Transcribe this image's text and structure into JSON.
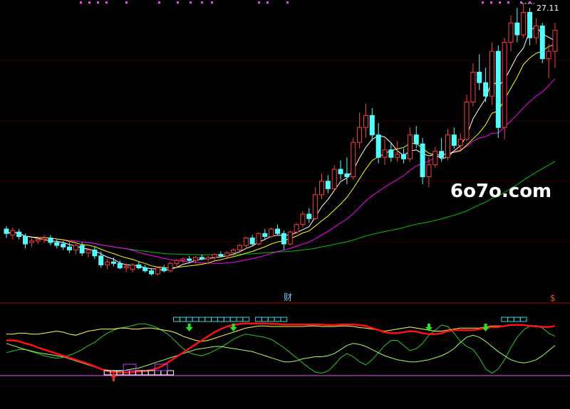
{
  "chart_data": {
    "type": "candlestick",
    "panels": [
      "price",
      "indicator"
    ],
    "price": {
      "last_price_label": "27.11",
      "ohlc": [
        [
          12.8,
          13.0,
          12.2,
          12.5
        ],
        [
          12.4,
          12.9,
          12.1,
          12.7
        ],
        [
          12.6,
          12.8,
          12.1,
          12.3
        ],
        [
          12.3,
          12.5,
          11.5,
          11.8
        ],
        [
          11.9,
          12.2,
          11.6,
          12.0
        ],
        [
          12.0,
          12.3,
          11.8,
          12.1
        ],
        [
          12.1,
          12.4,
          11.9,
          12.2
        ],
        [
          12.2,
          12.4,
          11.7,
          11.9
        ],
        [
          11.9,
          12.1,
          11.5,
          11.7
        ],
        [
          11.8,
          12.0,
          11.4,
          11.6
        ],
        [
          11.6,
          11.9,
          11.2,
          11.4
        ],
        [
          11.4,
          11.8,
          11.1,
          11.7
        ],
        [
          11.7,
          11.9,
          11.0,
          11.2
        ],
        [
          11.2,
          11.5,
          10.9,
          11.4
        ],
        [
          11.4,
          11.6,
          10.8,
          11.0
        ],
        [
          11.0,
          11.3,
          10.2,
          10.4
        ],
        [
          10.4,
          10.8,
          10.1,
          10.6
        ],
        [
          10.6,
          10.9,
          10.3,
          10.5
        ],
        [
          10.5,
          10.7,
          10.1,
          10.2
        ],
        [
          10.2,
          10.5,
          9.9,
          10.3
        ],
        [
          10.1,
          10.5,
          9.9,
          10.4
        ],
        [
          10.4,
          10.6,
          10.1,
          10.2
        ],
        [
          10.2,
          10.4,
          9.9,
          10.0
        ],
        [
          10.0,
          10.2,
          9.7,
          9.8
        ],
        [
          9.8,
          10.3,
          9.7,
          10.2
        ],
        [
          10.2,
          10.4,
          9.9,
          10.0
        ],
        [
          10.0,
          10.6,
          9.9,
          10.5
        ],
        [
          10.5,
          10.8,
          10.3,
          10.7
        ],
        [
          10.7,
          10.9,
          10.5,
          10.8
        ],
        [
          10.8,
          11.0,
          10.6,
          10.7
        ],
        [
          10.7,
          11.0,
          10.5,
          10.9
        ],
        [
          10.9,
          11.1,
          10.7,
          10.8
        ],
        [
          10.8,
          11.0,
          10.6,
          10.9
        ],
        [
          10.9,
          11.2,
          10.7,
          11.1
        ],
        [
          11.1,
          11.3,
          10.9,
          11.0
        ],
        [
          11.0,
          11.3,
          10.8,
          11.2
        ],
        [
          11.2,
          11.5,
          11.0,
          11.4
        ],
        [
          11.4,
          11.8,
          11.2,
          11.7
        ],
        [
          11.7,
          12.3,
          11.5,
          12.2
        ],
        [
          12.2,
          12.4,
          11.7,
          11.8
        ],
        [
          11.8,
          12.6,
          11.7,
          12.5
        ],
        [
          12.5,
          12.8,
          12.1,
          12.3
        ],
        [
          12.3,
          12.9,
          12.2,
          12.8
        ],
        [
          12.8,
          13.1,
          12.4,
          12.5
        ],
        [
          12.5,
          12.7,
          11.4,
          11.8
        ],
        [
          11.8,
          12.7,
          11.7,
          12.6
        ],
        [
          12.6,
          13.2,
          12.5,
          13.1
        ],
        [
          13.1,
          14.0,
          12.9,
          13.8
        ],
        [
          13.8,
          14.2,
          13.2,
          13.5
        ],
        [
          13.5,
          15.6,
          13.4,
          15.1
        ],
        [
          15.1,
          16.5,
          14.8,
          16.0
        ],
        [
          16.0,
          16.4,
          15.2,
          15.5
        ],
        [
          15.5,
          17.1,
          15.3,
          16.8
        ],
        [
          16.8,
          17.4,
          16.1,
          16.5
        ],
        [
          16.5,
          17.6,
          15.8,
          16.3
        ],
        [
          16.3,
          18.9,
          16.1,
          18.6
        ],
        [
          18.6,
          20.6,
          18.2,
          19.6
        ],
        [
          19.6,
          21.2,
          18.9,
          20.4
        ],
        [
          20.4,
          20.9,
          18.7,
          19.1
        ],
        [
          19.1,
          19.9,
          17.2,
          17.6
        ],
        [
          17.6,
          18.8,
          17.1,
          18.1
        ],
        [
          18.1,
          18.6,
          17.3,
          17.6
        ],
        [
          17.6,
          18.7,
          17.3,
          17.8
        ],
        [
          17.8,
          18.2,
          17.2,
          17.5
        ],
        [
          17.5,
          19.6,
          17.3,
          19.1
        ],
        [
          19.1,
          19.7,
          18.2,
          18.5
        ],
        [
          18.5,
          18.9,
          15.8,
          16.3
        ],
        [
          16.3,
          17.6,
          15.6,
          17.1
        ],
        [
          17.1,
          18.3,
          16.9,
          18.0
        ],
        [
          18.0,
          18.9,
          17.3,
          17.6
        ],
        [
          17.6,
          19.5,
          17.4,
          19.1
        ],
        [
          19.1,
          19.6,
          18.2,
          18.4
        ],
        [
          18.4,
          19.2,
          18.1,
          18.8
        ],
        [
          18.8,
          21.8,
          18.7,
          21.3
        ],
        [
          21.3,
          23.9,
          21.0,
          23.3
        ],
        [
          23.3,
          24.5,
          22.1,
          22.6
        ],
        [
          22.6,
          23.6,
          21.3,
          21.7
        ],
        [
          21.7,
          25.3,
          21.1,
          24.7
        ],
        [
          24.7,
          25.1,
          18.9,
          19.6
        ],
        [
          19.6,
          25.6,
          18.8,
          25.3
        ],
        [
          25.3,
          27.1,
          24.7,
          26.6
        ],
        [
          26.6,
          27.6,
          25.3,
          25.8
        ],
        [
          25.8,
          27.9,
          25.6,
          27.3
        ],
        [
          27.3,
          27.6,
          25.1,
          25.6
        ],
        [
          25.6,
          26.9,
          25.2,
          26.4
        ],
        [
          26.4,
          26.6,
          23.9,
          24.2
        ],
        [
          24.2,
          25.2,
          22.9,
          24.7
        ],
        [
          24.7,
          26.6,
          23.6,
          26.1
        ]
      ],
      "ma_colors": {
        "ma5": "#ffffff",
        "ma10": "#ffff00",
        "ma20": "#ff00ff",
        "ma60": "#00c000"
      },
      "up_color": "#ff3c3c",
      "down_color": "#54ffff",
      "top_marker_color": "#ff40ff"
    },
    "indicator": {
      "title_label": "财",
      "corner_label": "$",
      "line_red": [
        66,
        66,
        64,
        60,
        57,
        52,
        48,
        44,
        40,
        36,
        32,
        28,
        24,
        20,
        15,
        10,
        6,
        4,
        3,
        3,
        4,
        5,
        6,
        8,
        12,
        18,
        26,
        34,
        42,
        50,
        58,
        66,
        74,
        82,
        88,
        93,
        96,
        98,
        99,
        99,
        99,
        99,
        98,
        98,
        97,
        97,
        97,
        97,
        97,
        97,
        97,
        96,
        96,
        97,
        97,
        97,
        96,
        94,
        90,
        86,
        82,
        80,
        80,
        82,
        84,
        83,
        80,
        78,
        78,
        80,
        84,
        86,
        86,
        86,
        86,
        88,
        90,
        92,
        92,
        94,
        96,
        96,
        96,
        94,
        93,
        92,
        92,
        94
      ],
      "line_yellow": [
        78,
        78,
        80,
        80,
        78,
        78,
        80,
        82,
        84,
        82,
        78,
        76,
        80,
        84,
        86,
        88,
        88,
        88,
        90,
        90,
        88,
        88,
        90,
        90,
        88,
        86,
        84,
        80,
        74,
        70,
        66,
        64,
        66,
        70,
        74,
        78,
        82,
        86,
        90,
        92,
        94,
        94,
        93,
        93,
        93,
        93,
        93,
        93,
        94,
        94,
        93,
        93,
        93,
        94,
        94,
        93,
        91,
        90,
        88,
        86,
        84,
        86,
        88,
        90,
        92,
        90,
        88,
        86,
        84,
        84,
        86,
        88,
        90,
        90,
        90,
        90,
        92,
        94,
        94,
        94,
        96,
        96,
        96,
        95,
        94,
        93,
        92,
        94
      ],
      "line_green": [
        42,
        45,
        48,
        48,
        44,
        40,
        36,
        33,
        31,
        33,
        37,
        42,
        48,
        56,
        62,
        72,
        80,
        86,
        90,
        92,
        95,
        98,
        98,
        95,
        90,
        83,
        74,
        62,
        50,
        42,
        38,
        36,
        40,
        46,
        52,
        60,
        68,
        74,
        78,
        76,
        74,
        72,
        68,
        60,
        52,
        42,
        32,
        22,
        12,
        4,
        2,
        6,
        18,
        32,
        40,
        34,
        24,
        18,
        28,
        42,
        56,
        66,
        66,
        56,
        46,
        50,
        60,
        76,
        86,
        96,
        93,
        80,
        64,
        54,
        48,
        32,
        10,
        2,
        10,
        28,
        52,
        72,
        86,
        94,
        95,
        90,
        80,
        74
      ],
      "line_lightgreen": [
        60,
        56,
        52,
        48,
        45,
        42,
        40,
        38,
        36,
        34,
        30,
        26,
        22,
        18,
        14,
        10,
        8,
        6,
        6,
        8,
        10,
        12,
        16,
        20,
        24,
        28,
        32,
        36,
        40,
        44,
        48,
        50,
        52,
        54,
        54,
        52,
        50,
        48,
        46,
        44,
        40,
        36,
        32,
        28,
        24,
        24,
        26,
        30,
        32,
        34,
        34,
        36,
        40,
        48,
        56,
        60,
        58,
        54,
        48,
        42,
        36,
        32,
        28,
        26,
        24,
        24,
        26,
        28,
        32,
        36,
        42,
        50,
        62,
        72,
        76,
        72,
        64,
        54,
        44,
        36,
        28,
        24,
        22,
        24,
        28,
        36,
        46,
        56
      ],
      "top_bands": [
        [
          27,
          38
        ],
        [
          40,
          44
        ],
        [
          79,
          82
        ]
      ],
      "bottom_bands": [
        [
          16,
          21
        ],
        [
          22,
          26
        ]
      ],
      "down_arrows": [
        29,
        36,
        67,
        76
      ],
      "up_arrows": [
        17
      ],
      "colors": {
        "red": "#ff1010",
        "yellow": "#ffff40",
        "green": "#28c828",
        "lightgreen": "#a8ff60",
        "band": "#30d8e8",
        "arrow_down": "#28e028",
        "arrow_up": "#ff3030",
        "baseline": "#ff40ff"
      }
    }
  },
  "watermark": {
    "text": "6o7o.com"
  }
}
